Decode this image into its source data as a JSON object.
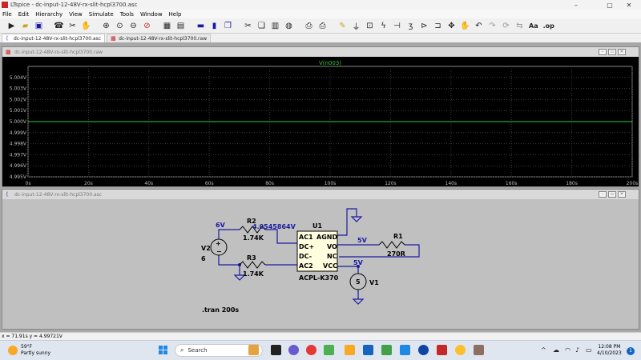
{
  "window": {
    "title": "LTspice - dc-input-12-48V-rx-slit-hcpl3700.asc",
    "controls": [
      "–",
      "▢",
      "✕"
    ]
  },
  "menu": [
    "File",
    "Edit",
    "Hierarchy",
    "View",
    "Simulate",
    "Tools",
    "Window",
    "Help"
  ],
  "toolbar": {
    "icons": [
      "run",
      "open",
      "save",
      "control-panel",
      "halt",
      "pan",
      "zoom-in",
      "zoom-pan",
      "zoom-out",
      "zoom-cancel",
      "autorange",
      "fit",
      "tile-horizontal",
      "tile-vertical",
      "cascade",
      "cut",
      "copy",
      "paste",
      "find",
      "print-setup",
      "print",
      "draw-wire",
      "ground",
      "label",
      "resistor",
      "capacitor",
      "inductor",
      "diode",
      "component",
      "move",
      "drag",
      "undo",
      "redo",
      "rotate",
      "mirror",
      "text",
      "spice-directive"
    ],
    "text_label": "Aa",
    "op_label": ".op"
  },
  "tabs": [
    {
      "label": "dc-input-12-48V-rx-slit-hcpl3700.asc",
      "icon": "schematic-icon",
      "active": true
    },
    {
      "label": "dc-input-12-48V-rx-slit-hcpl3700.raw",
      "icon": "waveform-icon",
      "active": false
    }
  ],
  "waveform_window": {
    "title": "dc-input-12-48V-rx-slit-hcpl3700.raw",
    "trace_label": "V(n003)",
    "trace_color": "#2ecc40",
    "grid_color": "#3a3a3a"
  },
  "schematic_window": {
    "title": "dc-input-12-48V-rx-slit-hcpl3700.asc",
    "labels": {
      "v2_node": "6V",
      "r2_name": "R2",
      "r2_value": "1.74K",
      "node_voltage": "4.0545864V",
      "u1_name": "U1",
      "u1_part": "ACPL-K370",
      "pin_ac1": "AC1",
      "pin_dcp": "DC+",
      "pin_dcm": "DC-",
      "pin_ac2": "AC2",
      "pin_agnd": "AGND",
      "pin_vo": "VO",
      "pin_nc": "NC",
      "pin_vcc": "VCC",
      "v2_name": "V2",
      "v2_value": "6",
      "r3_name": "R3",
      "r3_value": "1.74K",
      "vo_node": "5V",
      "r1_name": "R1",
      "r1_value": "270R",
      "vcc_node": "5V",
      "v1_name": "V1",
      "v1_symbol": "5",
      "directive": ".tran 200s"
    },
    "wire_color": "#1a1aa0",
    "part_color": "#800000"
  },
  "status": {
    "text": "x = 71.91s    y = 4.99721V"
  },
  "taskbar": {
    "weather_temp": "59°F",
    "weather_desc": "Partly sunny",
    "search_label": "Search",
    "time": "12:08 PM",
    "date": "4/10/2023",
    "notification_count": "1"
  },
  "chart_data": {
    "type": "line",
    "title": "V(n003)",
    "xlabel": "",
    "ylabel": "",
    "x_ticks": [
      "0s",
      "20s",
      "40s",
      "60s",
      "80s",
      "100s",
      "120s",
      "140s",
      "160s",
      "180s",
      "200s"
    ],
    "y_ticks": [
      "5.004V",
      "5.003V",
      "5.002V",
      "5.001V",
      "5.000V",
      "4.999V",
      "4.998V",
      "4.997V",
      "4.996V",
      "4.995V"
    ],
    "xlim": [
      0,
      200
    ],
    "ylim": [
      4.995,
      5.005
    ],
    "series": [
      {
        "name": "V(n003)",
        "x": [
          0,
          200
        ],
        "y": [
          5.0,
          5.0
        ]
      }
    ],
    "grid": true
  }
}
